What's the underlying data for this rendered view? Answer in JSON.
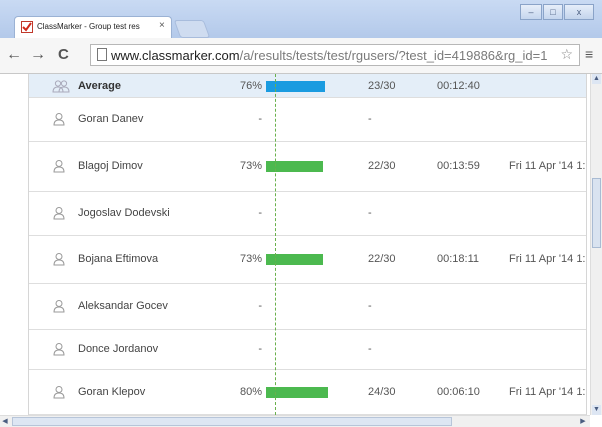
{
  "browser": {
    "tab_title": "ClassMarker - Group test res",
    "tab_close": "×",
    "url_host": "www.classmarker.com",
    "url_path": "/a/results/tests/test/rgusers/?test_id=419886&rg_id=1",
    "back": "←",
    "forward": "→",
    "reload": "C",
    "star": "☆",
    "menu": "≡",
    "minimize": "–",
    "maximize": "□",
    "close": "x"
  },
  "colors": {
    "average_bar": "#1a9be0",
    "result_bar": "#4cb94f",
    "median_line": "#6ab04c"
  },
  "rows": [
    {
      "name": "Average",
      "percent": "76%",
      "score": "23/30",
      "duration": "00:12:40",
      "date": "",
      "bar_percent": 76,
      "is_average": true
    },
    {
      "name": "Goran Danev",
      "percent": "-",
      "score": "-",
      "duration": "",
      "date": "",
      "bar_percent": 0,
      "is_average": false
    },
    {
      "name": "Blagoj Dimov",
      "percent": "73%",
      "score": "22/30",
      "duration": "00:13:59",
      "date": "Fri 11 Apr '14 1:",
      "bar_percent": 73,
      "is_average": false
    },
    {
      "name": "Jogoslav Dodevski",
      "percent": "-",
      "score": "-",
      "duration": "",
      "date": "",
      "bar_percent": 0,
      "is_average": false
    },
    {
      "name": "Bojana Eftimova",
      "percent": "73%",
      "score": "22/30",
      "duration": "00:18:11",
      "date": "Fri 11 Apr '14 1:",
      "bar_percent": 73,
      "is_average": false
    },
    {
      "name": "Aleksandar Gocev",
      "percent": "-",
      "score": "-",
      "duration": "",
      "date": "",
      "bar_percent": 0,
      "is_average": false
    },
    {
      "name": "Donce Jordanov",
      "percent": "-",
      "score": "-",
      "duration": "",
      "date": "",
      "bar_percent": 0,
      "is_average": false
    },
    {
      "name": "Goran Klepov",
      "percent": "80%",
      "score": "24/30",
      "duration": "00:06:10",
      "date": "Fri 11 Apr '14 1:",
      "bar_percent": 80,
      "is_average": false
    }
  ]
}
